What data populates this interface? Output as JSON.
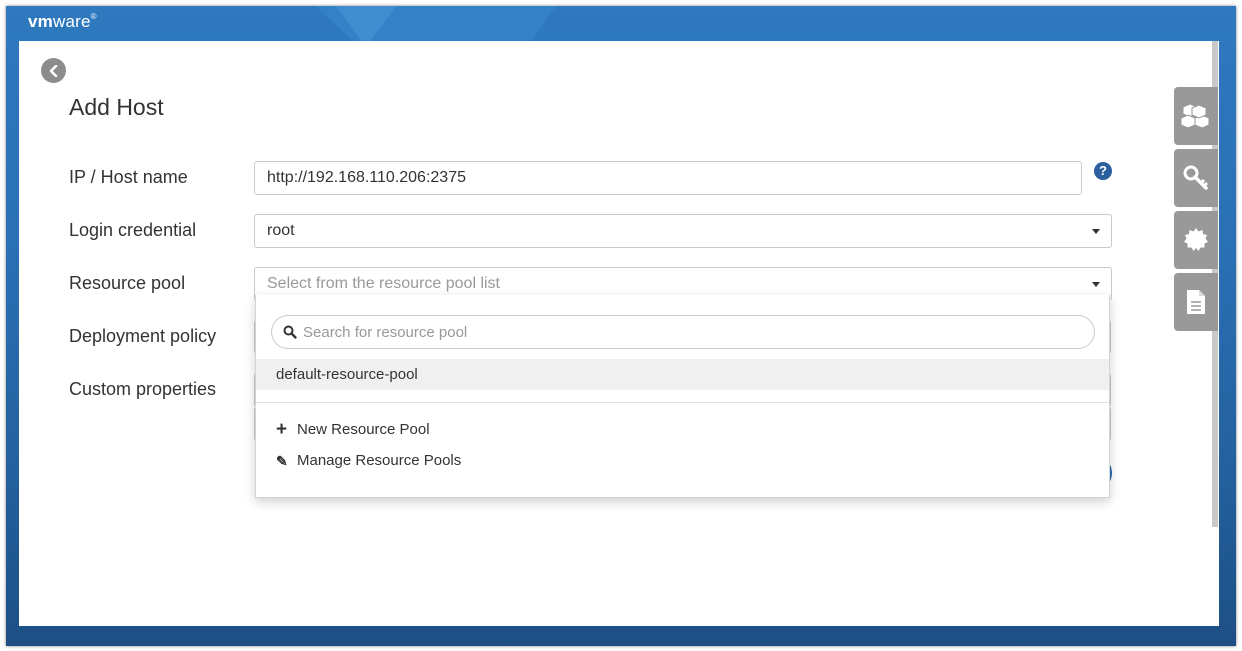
{
  "brand": {
    "logo_bold": "vm",
    "logo_light": "ware",
    "logo_mark": "®"
  },
  "page": {
    "title": "Add Host"
  },
  "form": {
    "ip_label": "IP / Host name",
    "ip_value": "http://192.168.110.206:2375",
    "credential_label": "Login credential",
    "credential_value": "root",
    "resource_pool_label": "Resource pool",
    "resource_pool_placeholder": "Select from the resource pool list",
    "deployment_policy_label": "Deployment policy",
    "custom_properties_label": "Custom properties",
    "help_glyph": "?"
  },
  "dropdown": {
    "search_placeholder": "Search for resource pool",
    "options": [
      "default-resource-pool"
    ],
    "actions": [
      {
        "icon": "plus-icon",
        "glyph": "+",
        "label": "New Resource Pool"
      },
      {
        "icon": "pencil-icon",
        "glyph": "✎",
        "label": "Manage Resource Pools"
      }
    ]
  },
  "right_toolbar": {
    "tabs": [
      "cubes-icon",
      "key-icon",
      "certificate-icon",
      "document-icon"
    ]
  },
  "colors": {
    "header_blue": "#2f79bf",
    "help_blue": "#2b5f9e",
    "tab_gray": "#999999"
  }
}
